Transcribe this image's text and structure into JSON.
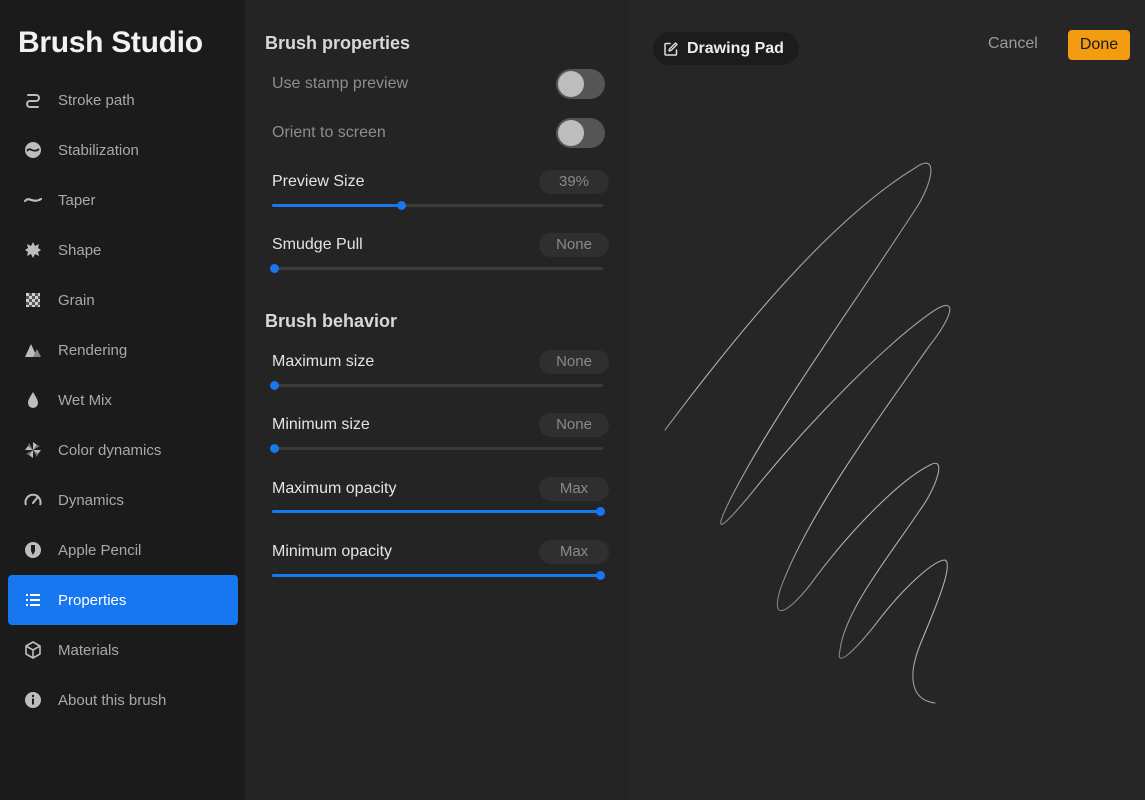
{
  "sidebar": {
    "title": "Brush Studio",
    "items": [
      {
        "label": "Stroke path",
        "icon": "stroke-path-icon"
      },
      {
        "label": "Stabilization",
        "icon": "stabilization-icon"
      },
      {
        "label": "Taper",
        "icon": "taper-icon"
      },
      {
        "label": "Shape",
        "icon": "shape-icon"
      },
      {
        "label": "Grain",
        "icon": "grain-icon"
      },
      {
        "label": "Rendering",
        "icon": "rendering-icon"
      },
      {
        "label": "Wet Mix",
        "icon": "wet-mix-icon"
      },
      {
        "label": "Color dynamics",
        "icon": "color-dynamics-icon"
      },
      {
        "label": "Dynamics",
        "icon": "dynamics-icon"
      },
      {
        "label": "Apple Pencil",
        "icon": "apple-pencil-icon"
      },
      {
        "label": "Properties",
        "icon": "properties-icon",
        "active": true
      },
      {
        "label": "Materials",
        "icon": "materials-icon"
      },
      {
        "label": "About this brush",
        "icon": "about-icon"
      }
    ]
  },
  "properties": {
    "section_title": "Brush properties",
    "use_stamp_preview": {
      "label": "Use stamp preview",
      "on": false
    },
    "orient_to_screen": {
      "label": "Orient to screen",
      "on": false
    },
    "preview_size": {
      "label": "Preview Size",
      "value_text": "39%",
      "fraction": 0.39
    },
    "smudge_pull": {
      "label": "Smudge Pull",
      "value_text": "None",
      "fraction": 0
    }
  },
  "behavior": {
    "section_title": "Brush behavior",
    "max_size": {
      "label": "Maximum size",
      "value_text": "None",
      "fraction": 0
    },
    "min_size": {
      "label": "Minimum size",
      "value_text": "None",
      "fraction": 0
    },
    "max_opacity": {
      "label": "Maximum opacity",
      "value_text": "Max",
      "fraction": 1
    },
    "min_opacity": {
      "label": "Minimum opacity",
      "value_text": "Max",
      "fraction": 1
    }
  },
  "pad": {
    "chip_label": "Drawing Pad",
    "chip_icon": "edit-icon",
    "cancel_label": "Cancel",
    "done_label": "Done"
  },
  "colors": {
    "accent": "#1677f0",
    "done": "#f39c12"
  }
}
